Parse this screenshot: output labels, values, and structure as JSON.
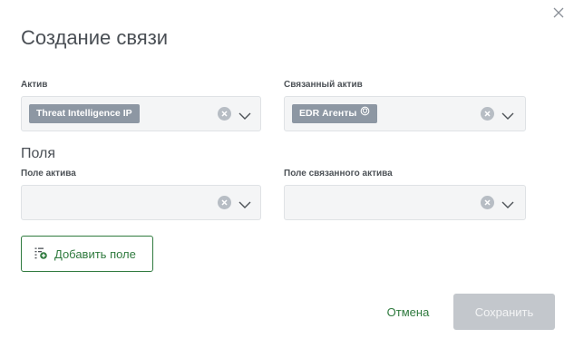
{
  "dialog": {
    "title": "Создание связи",
    "close_icon": "close-icon"
  },
  "asset": {
    "label": "Актив",
    "chip": "Threat Intelligence IP"
  },
  "linked_asset": {
    "label": "Связанный актив",
    "chip": "EDR Агенты",
    "chip_icon": "shield-icon"
  },
  "fields_section": {
    "title": "Поля",
    "asset_field_label": "Поле актива",
    "linked_asset_field_label": "Поле связанного актива"
  },
  "actions": {
    "add_field": "Добавить поле",
    "add_field_icon": "list-add-icon",
    "cancel": "Отмена",
    "save": "Сохранить"
  },
  "colors": {
    "accent": "#2f7a3e",
    "chip": "#8d97a3",
    "disabled_button": "#c3c7cc"
  }
}
